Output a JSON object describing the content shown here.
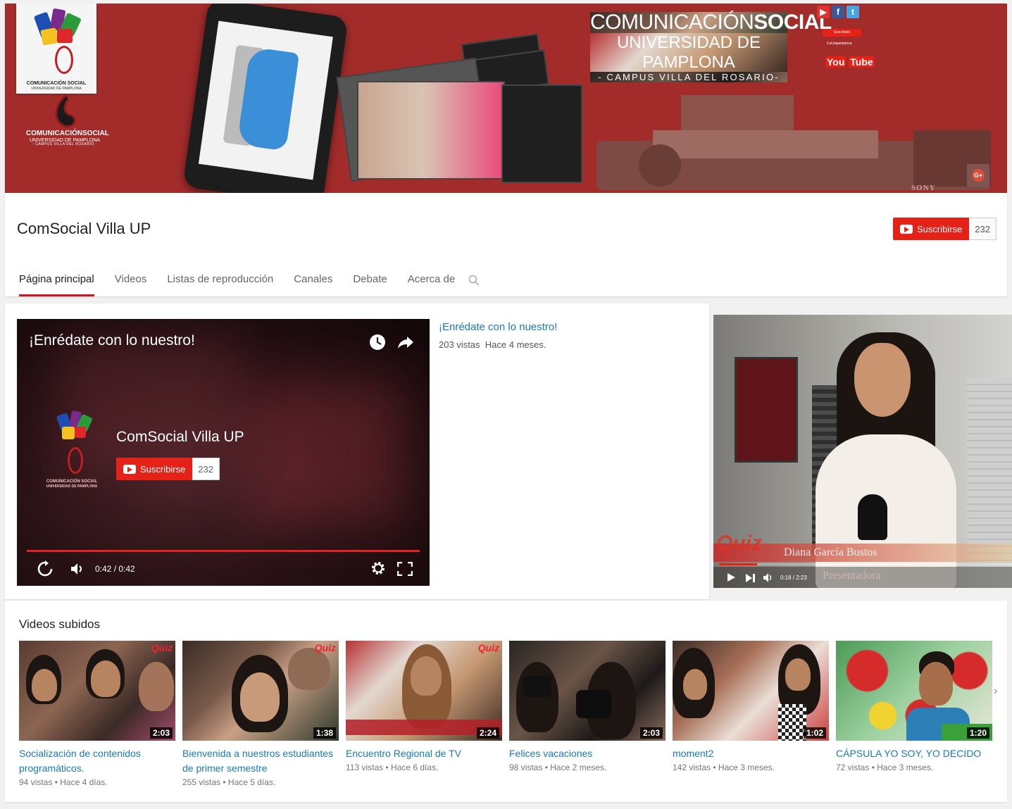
{
  "banner": {
    "logo_small_title": "COMUNICACIÓN SOCIAL",
    "logo_small_sub": "UNIVERSIDAD DE PAMPLONA",
    "logo2_line1": "COMUNICACIÓNSOCIAL",
    "logo2_line2": "UNIVERSIDAD DE PAMPLONA",
    "logo2_line3": "- CAMPUS VILLA DEL ROSARIO -",
    "title_light": "COMUNICACIÓN",
    "title_bold": "SOCIAL",
    "title_line2": "UNIVERSIDAD DE PAMPLONA",
    "title_line3": "- CAMPUS VILLA DEL ROSARIO-",
    "social_subscribe": "Suscribete",
    "social_handle": "CsUnipamplona",
    "social_youtube_1": "You",
    "social_youtube_2": "Tube",
    "camera_brand": "SONY",
    "gplus_label": "G+",
    "accent_color": "#a32c2b"
  },
  "channel": {
    "name": "ComSocial Villa UP",
    "subscribe_label": "Suscribirse",
    "subscriber_count": "232"
  },
  "tabs": [
    {
      "label": "Página principal",
      "active": true
    },
    {
      "label": "Videos"
    },
    {
      "label": "Listas de reproducción"
    },
    {
      "label": "Canales"
    },
    {
      "label": "Debate"
    },
    {
      "label": "Acerca de"
    }
  ],
  "featured": {
    "player_title": "¡Enrédate con lo nuestro!",
    "endcard_channel": "ComSocial Villa UP",
    "endcard_logo_line1": "COMUNICACIÓN SOCIAL",
    "endcard_logo_line2": "UNIVERSIDAD DE PAMPLONA",
    "subscribe_label": "Suscribirse",
    "subscriber_count": "232",
    "time": "0:42 / 0:42",
    "link_title": "¡Enrédate con lo nuestro!",
    "views": "203 vistas",
    "age": "Hace 4 meses."
  },
  "side_video": {
    "overlay_brand": "Quiz",
    "overlay_name": "Diana García Bustos",
    "overlay_role": "Presentadora",
    "time": "0:18 / 2:23",
    "progress": 0.13
  },
  "uploads": {
    "title": "Videos subidos",
    "items": [
      {
        "title": "Socialización de contenidos programáticos.",
        "views": "94 vistas",
        "age": "Hace 4 días.",
        "duration": "2:03",
        "quiz": "Quiz"
      },
      {
        "title": "Bienvenida a nuestros estudiantes de primer semestre",
        "views": "255 vistas",
        "age": "Hace 5 días.",
        "duration": "1:38",
        "quiz": "Quiz"
      },
      {
        "title": "Encuentro Regional de TV",
        "views": "113 vistas",
        "age": "Hace 6 días.",
        "duration": "2:24",
        "quiz": "Quiz"
      },
      {
        "title": "Felices vacaciones",
        "views": "98 vistas",
        "age": "Hace 2 meses.",
        "duration": "2:03",
        "quiz": ""
      },
      {
        "title": "moment2",
        "views": "142 vistas",
        "age": "Hace 3 meses.",
        "duration": "1:02",
        "quiz": ""
      },
      {
        "title": "CÁPSULA YO SOY, YO DECIDO",
        "views": "72 vistas",
        "age": "Hace 3 meses.",
        "duration": "1:20",
        "quiz": ""
      }
    ],
    "separator": "•",
    "next_arrow": "›"
  }
}
